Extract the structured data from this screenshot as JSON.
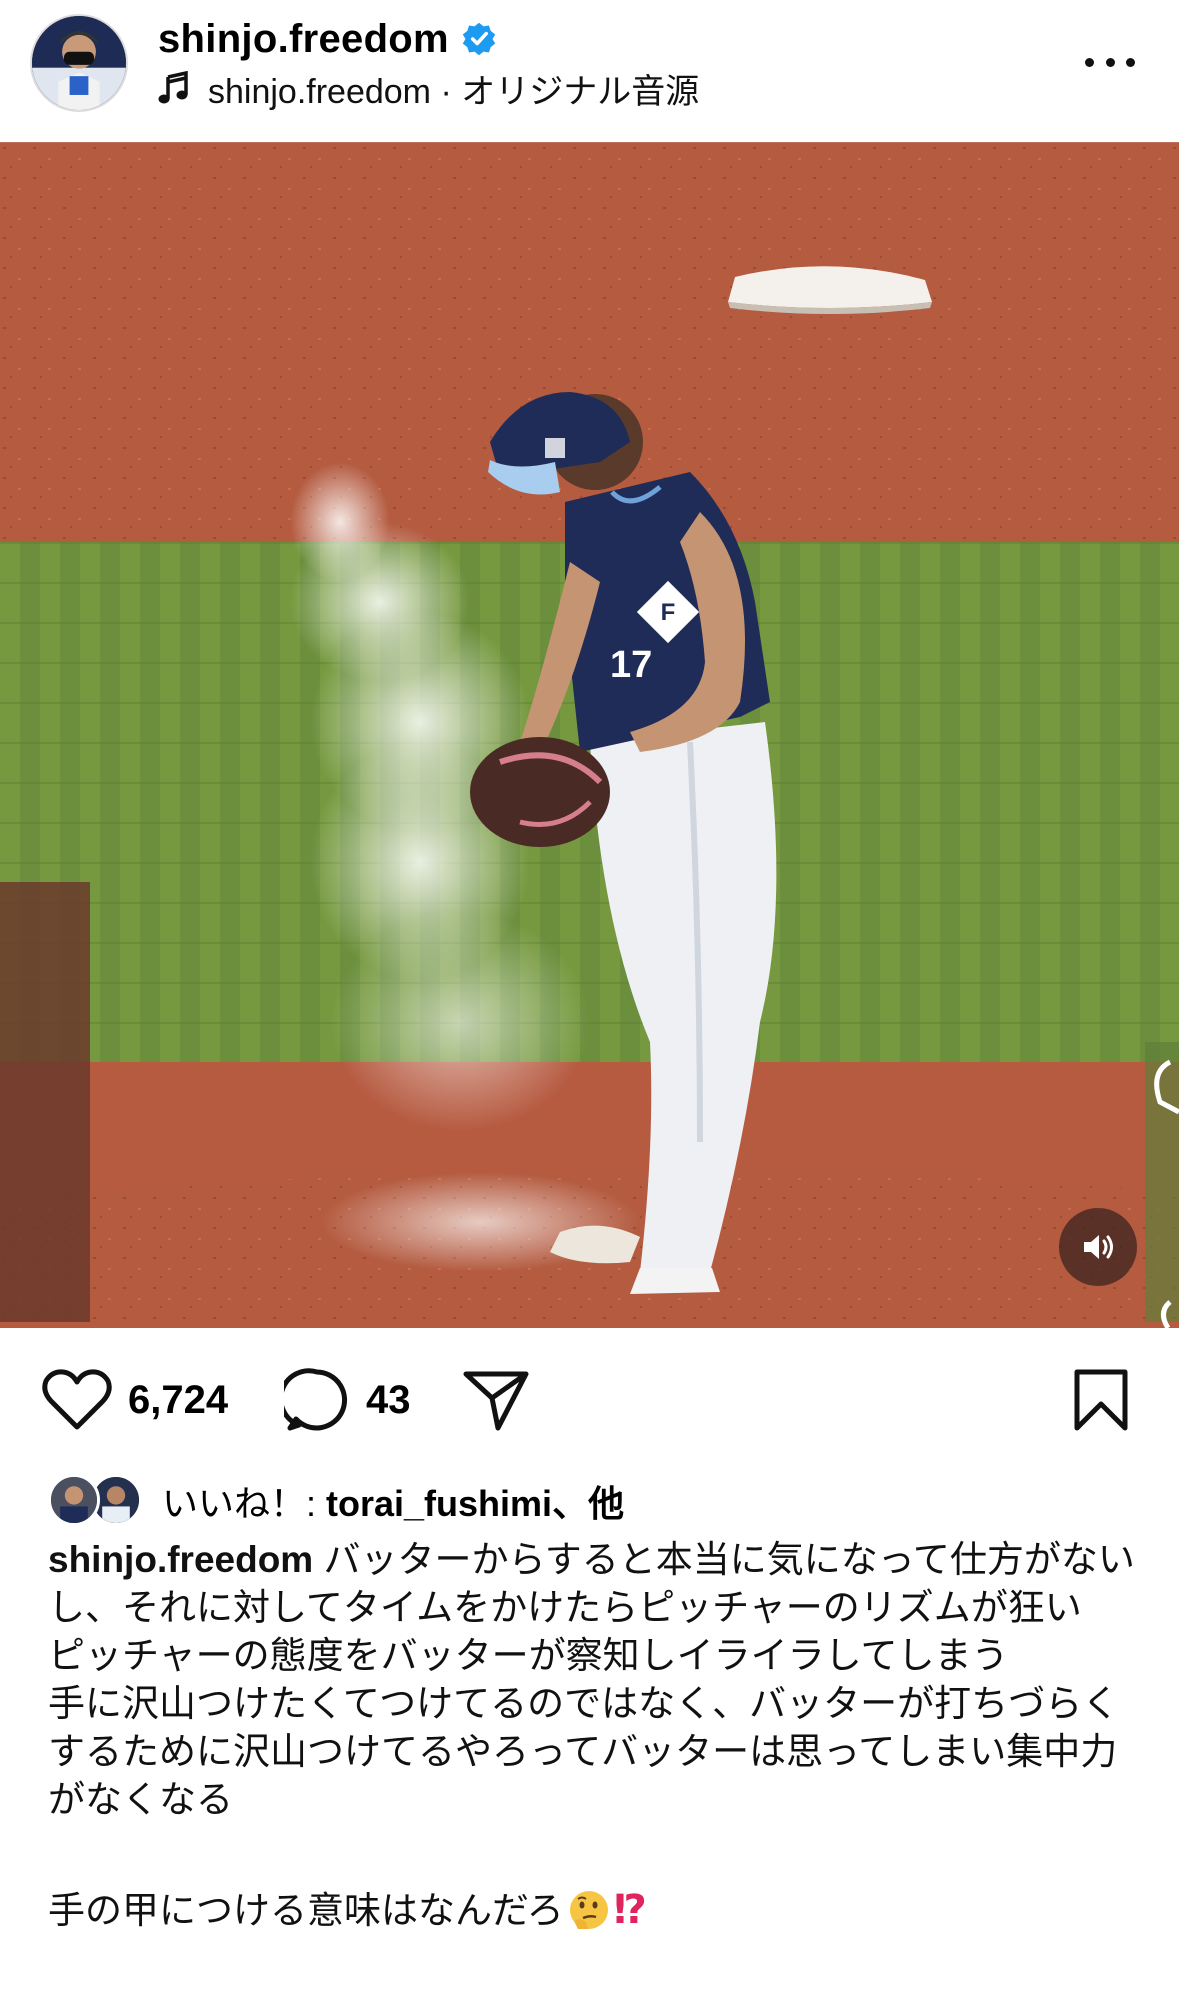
{
  "header": {
    "username": "shinjo.freedom",
    "audio_label": "shinjo.freedom · オリジナル音源"
  },
  "media": {
    "jersey_number": "17"
  },
  "actions": {
    "like_count": "6,724",
    "comment_count": "43"
  },
  "likes": {
    "prefix": "いいね！: ",
    "user": "torai_fushimi",
    "suffix": "、他"
  },
  "caption": {
    "username": "shinjo.freedom",
    "lines": [
      "バッターからすると本当に気になって仕方がないし、それに対してタイムをかけたらピッチャーのリズムが狂い",
      "ピッチャーの態度をバッターが察知しイライラしてしまう",
      "手に沢山つけたくてつけてるのではなく、バッターが打ちづらくするために沢山つけてるやろってバッターは思ってしまい集中力がなくなる",
      "手の甲につける意味はなんだろ"
    ],
    "end_emoji": "⁉"
  }
}
